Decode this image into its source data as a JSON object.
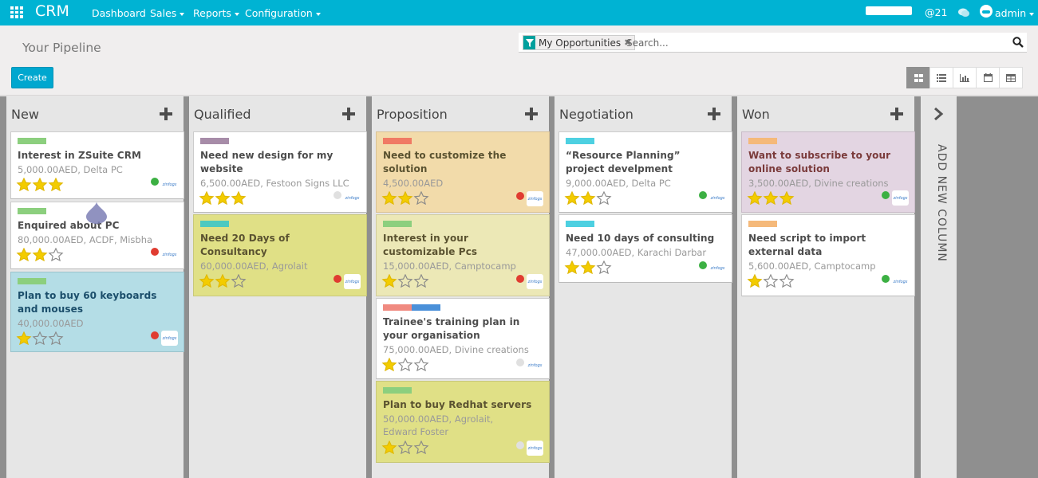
{
  "navbar": {
    "brand": "CRM",
    "menu": [
      {
        "label": "Dashboard",
        "dropdown": false
      },
      {
        "label": "Sales",
        "dropdown": true
      },
      {
        "label": "Reports",
        "dropdown": true
      },
      {
        "label": "Configuration",
        "dropdown": true
      }
    ],
    "mentions": "@21",
    "user": "admin",
    "accent_color": "#00b3d3"
  },
  "control_panel": {
    "title": "Your Pipeline",
    "create_label": "Create",
    "search": {
      "facet_label": "My Opportunities",
      "facet_remove": "✖",
      "placeholder": "Search..."
    },
    "views": [
      "kanban-icon",
      "list-icon",
      "graph-icon",
      "calendar-icon",
      "pivot-icon"
    ],
    "active_view": "kanban"
  },
  "kanban": {
    "columns": [
      {
        "title": "New",
        "cards": [
          {
            "tags": [
              "#8ccf7e"
            ],
            "title": "Interest in ZSuite CRM",
            "meta": "5,000.00AED, Delta PC",
            "stars": 3,
            "status": "#3cb043",
            "bg": "white"
          },
          {
            "tags": [
              "#8ccf7e"
            ],
            "title": "Enquired about PC",
            "meta": "80,000.00AED, ACDF, Misbha",
            "stars": 2,
            "status": "#e03c31",
            "bg": "white"
          },
          {
            "tags": [
              "#8ccf7e"
            ],
            "title": "Plan to buy 60 keyboards and mouses",
            "meta": "40,000.00AED",
            "stars": 1,
            "status": "#e03c31",
            "bg": "blue"
          }
        ]
      },
      {
        "title": "Qualified",
        "cards": [
          {
            "tags": [
              "#a78ca8"
            ],
            "title": "Need new design for my website",
            "meta": "6,500.00AED, Festoon Signs LLC",
            "stars": 3,
            "status": "#e0e0e0",
            "bg": "white"
          },
          {
            "tags": [
              "#4cc9c0"
            ],
            "title": "Need 20 Days of Consultancy",
            "meta": "60,000.00AED, Agrolait",
            "stars": 2,
            "status": "#e03c31",
            "bg": "green"
          }
        ]
      },
      {
        "title": "Proposition",
        "cards": [
          {
            "tags": [
              "#f07a64"
            ],
            "title": "Need to customize the solution",
            "meta": "4,500.00AED",
            "stars": 2,
            "status": "#e03c31",
            "bg": "orange"
          },
          {
            "tags": [
              "#8ccf7e"
            ],
            "title": "Interest in your customizable Pcs",
            "meta": "15,000.00AED, Camptocamp",
            "stars": 1,
            "status": "#e03c31",
            "bg": "khaki"
          },
          {
            "tags": [
              "#f08a80",
              "#4a90d9"
            ],
            "title": "Trainee's training plan in your organisation",
            "meta": "75,000.00AED, Divine creations",
            "stars": 1,
            "status": "#e0e0e0",
            "bg": "white"
          },
          {
            "tags": [
              "#8ccf7e"
            ],
            "title": "Plan to buy Redhat servers",
            "meta": "50,000.00AED, Agrolait, Edward Foster",
            "stars": 1,
            "status": "#e0e0e0",
            "bg": "green"
          }
        ]
      },
      {
        "title": "Negotiation",
        "cards": [
          {
            "tags": [
              "#4dd0e1"
            ],
            "title": "“Resource Planning” project develpment",
            "meta": "9,000.00AED, Delta PC",
            "stars": 2,
            "status": "#3cb043",
            "bg": "white"
          },
          {
            "tags": [
              "#4dd0e1"
            ],
            "title": "Need 10 days of consulting",
            "meta": "47,000.00AED, Karachi Darbar",
            "stars": 2,
            "status": "#3cb043",
            "bg": "white"
          }
        ]
      },
      {
        "title": "Won",
        "cards": [
          {
            "tags": [
              "#f5b97a"
            ],
            "title": "Want to subscribe to your online solution",
            "meta": "3,500.00AED, Divine creations",
            "stars": 3,
            "status": "#3cb043",
            "bg": "purple"
          },
          {
            "tags": [
              "#f5b97a"
            ],
            "title": "Need script to import external data",
            "meta": "5,600.00AED, Camptocamp",
            "stars": 1,
            "status": "#3cb043",
            "bg": "white"
          }
        ]
      }
    ],
    "add_column_label": "ADD NEW COLUMN"
  }
}
